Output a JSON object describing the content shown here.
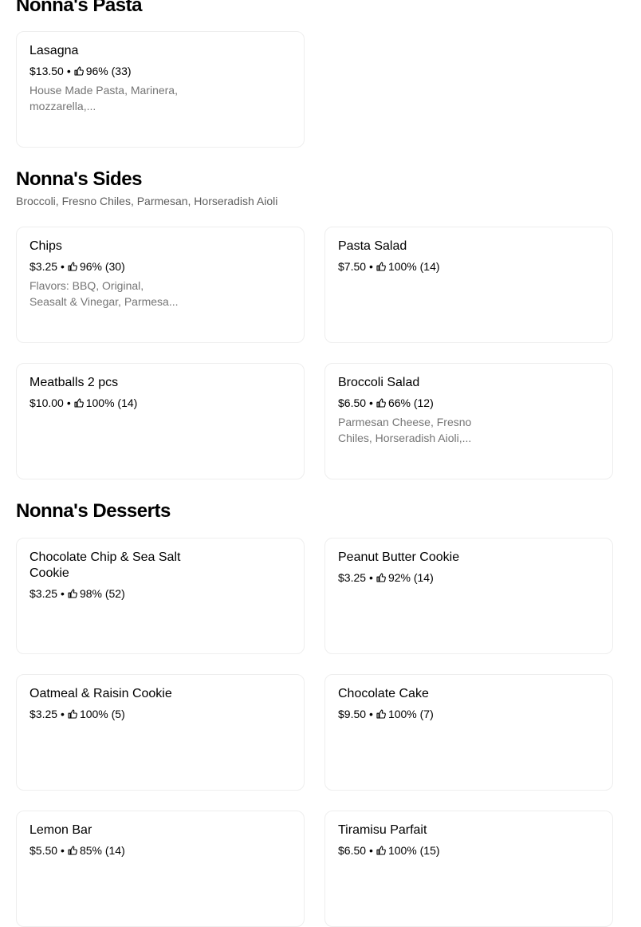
{
  "sections": {
    "pasta": {
      "title": "Nonna's Pasta",
      "items": [
        {
          "name": "Lasagna",
          "price": "$13.50",
          "rating": "96% (33)",
          "desc": "House Made Pasta, Marinera, mozzarella,..."
        }
      ]
    },
    "sides": {
      "title": "Nonna's Sides",
      "subtitle": "Broccoli, Fresno Chiles, Parmesan, Horseradish Aioli",
      "items": [
        {
          "name": "Chips",
          "price": "$3.25",
          "rating": "96% (30)",
          "desc": "Flavors: BBQ, Original, Seasalt & Vinegar, Parmesa..."
        },
        {
          "name": "Pasta Salad",
          "price": "$7.50",
          "rating": "100% (14)"
        },
        {
          "name": "Meatballs 2 pcs",
          "price": "$10.00",
          "rating": "100% (14)"
        },
        {
          "name": "Broccoli Salad",
          "price": "$6.50",
          "rating": "66% (12)",
          "desc": "Parmesan Cheese, Fresno Chiles, Horseradish Aioli,..."
        }
      ]
    },
    "desserts": {
      "title": "Nonna's Desserts",
      "items": [
        {
          "name": "Chocolate Chip & Sea Salt Cookie",
          "price": "$3.25",
          "rating": "98% (52)"
        },
        {
          "name": "Peanut Butter Cookie",
          "price": "$3.25",
          "rating": "92% (14)"
        },
        {
          "name": "Oatmeal & Raisin Cookie",
          "price": "$3.25",
          "rating": "100% (5)"
        },
        {
          "name": "Chocolate Cake",
          "price": "$9.50",
          "rating": "100% (7)"
        },
        {
          "name": "Lemon Bar",
          "price": "$5.50",
          "rating": "85% (14)"
        },
        {
          "name": "Tiramisu Parfait",
          "price": "$6.50",
          "rating": "100% (15)"
        }
      ]
    }
  },
  "separator": "•",
  "rating_icon": "thumbs-up-icon",
  "colors": {
    "text": "#000000",
    "secondary": "#757575",
    "border": "#eeeeee"
  }
}
